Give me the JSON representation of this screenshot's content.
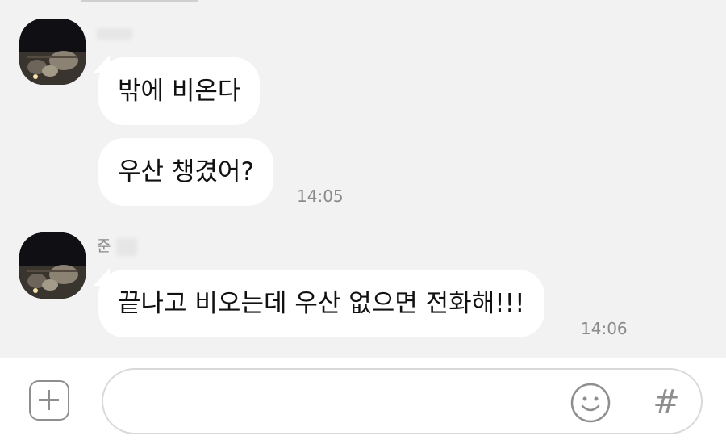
{
  "messages": [
    {
      "sender": "",
      "bubbles": [
        {
          "text": "밖에 비온다"
        },
        {
          "text": "우산 챙겼어?"
        }
      ],
      "time": "14:05"
    },
    {
      "sender": "준",
      "bubbles": [
        {
          "text": "끝나고 비오는데 우산 없으면 전화해!!!"
        }
      ],
      "time": "14:06"
    }
  ],
  "input_bar": {
    "plus_icon": "plus-icon",
    "message_value": "",
    "message_placeholder": "",
    "emoji_icon": "smiley-icon",
    "hash_label": "#"
  },
  "colors": {
    "chat_background": "#f2f2f2",
    "bubble": "#ffffff",
    "meta_text": "#8a8a8a",
    "icon": "#8e8e8e"
  }
}
